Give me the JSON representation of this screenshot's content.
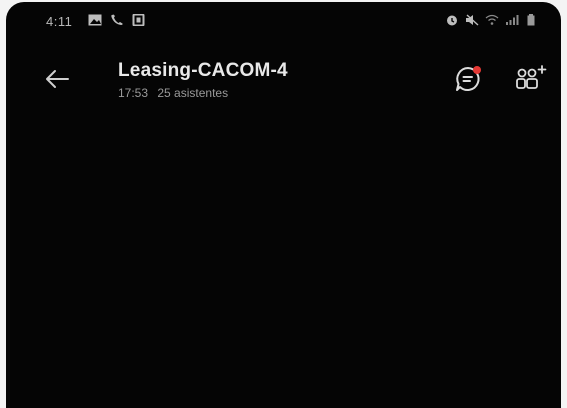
{
  "status_bar": {
    "time": "4:11",
    "left_icons": [
      "gallery-icon",
      "phone-icon",
      "square-app-icon"
    ],
    "right_icons": [
      "alarm-icon",
      "mute-icon",
      "wifi-icon",
      "signal-icon",
      "battery-icon"
    ]
  },
  "header": {
    "title": "Leasing-CACOM-4",
    "duration": "17:53",
    "attendees": "25 asistentes"
  },
  "colors": {
    "background": "#050505",
    "title": "#e9e9e9",
    "subtitle": "#9a9a9a",
    "notification_dot": "#e53935"
  }
}
